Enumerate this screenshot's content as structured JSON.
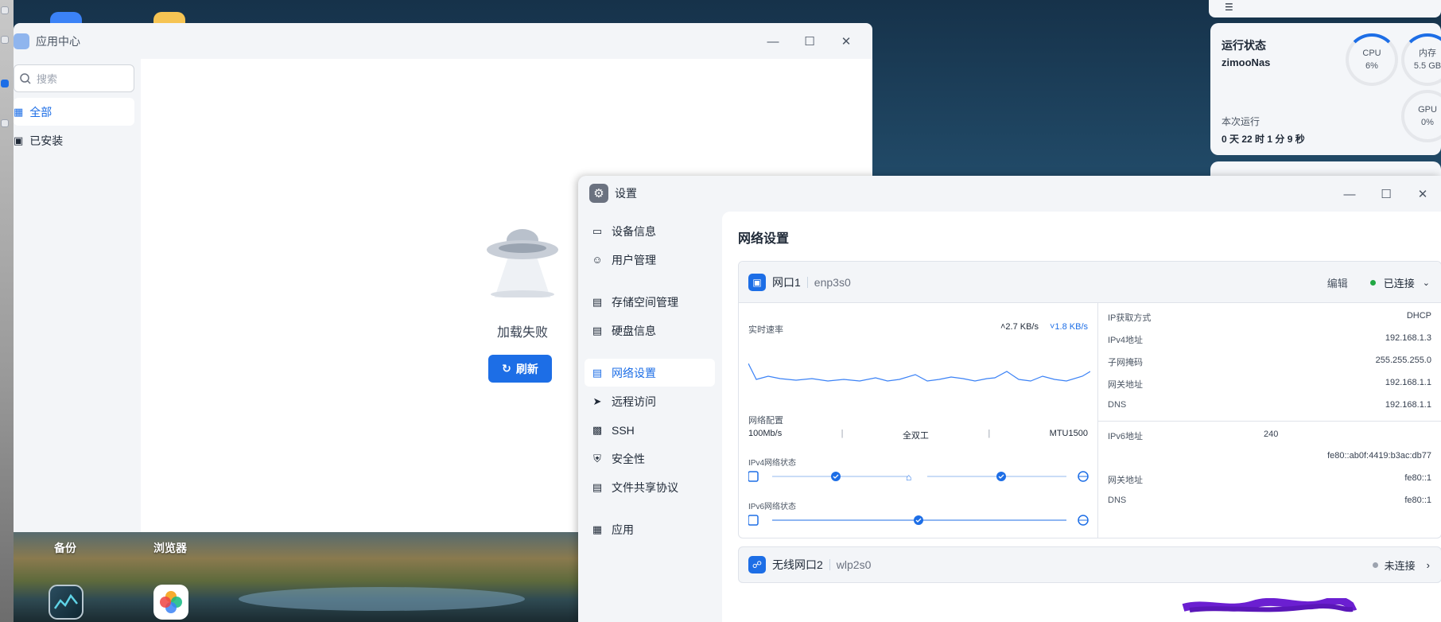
{
  "app_center": {
    "title": "应用中心",
    "search_placeholder": "搜索",
    "nav": [
      {
        "label": "全部"
      },
      {
        "label": "已安装"
      }
    ],
    "empty_state": "加载失败",
    "refresh_label": "刷新"
  },
  "desktop": {
    "labels": [
      "备份",
      "浏览器"
    ]
  },
  "status_widget": {
    "title": "运行状态",
    "host": "zimooNas",
    "uptime_label": "本次运行",
    "uptime_value": "0 天 22 时 1 分 9 秒",
    "gauges": [
      {
        "name": "CPU",
        "value": "6%"
      },
      {
        "name": "内存",
        "value": "5.5 GB"
      },
      {
        "name": "GPU",
        "value": "0%"
      }
    ]
  },
  "settings": {
    "title": "设置",
    "nav": [
      {
        "label": "设备信息",
        "icon": "device-icon"
      },
      {
        "label": "用户管理",
        "icon": "user-icon"
      },
      {
        "label": "存储空间管理",
        "icon": "storage-icon"
      },
      {
        "label": "硬盘信息",
        "icon": "disk-icon"
      },
      {
        "label": "网络设置",
        "icon": "network-icon"
      },
      {
        "label": "远程访问",
        "icon": "remote-icon"
      },
      {
        "label": "SSH",
        "icon": "ssh-icon"
      },
      {
        "label": "安全性",
        "icon": "shield-icon"
      },
      {
        "label": "文件共享协议",
        "icon": "file-share-icon"
      },
      {
        "label": "应用",
        "icon": "apps-icon"
      }
    ],
    "section_title": "网络设置",
    "port1": {
      "name": "网口1",
      "device": "enp3s0",
      "edit_label": "编辑",
      "status": "已连接",
      "speed_label": "实时速率",
      "upload": "2.7 KB/s",
      "download": "1.8 KB/s",
      "config_label": "网络配置",
      "link_speed": "100Mb/s",
      "duplex": "全双工",
      "mtu": "MTU1500",
      "ipv4_state_label": "IPv4网络状态",
      "ipv6_state_label": "IPv6网络状态",
      "ipv4_info": [
        {
          "k": "IP获取方式",
          "v": "DHCP"
        },
        {
          "k": "IPv4地址",
          "v": "192.168.1.3"
        },
        {
          "k": "子网掩码",
          "v": "255.255.255.0"
        },
        {
          "k": "网关地址",
          "v": "192.168.1.1"
        },
        {
          "k": "DNS",
          "v": "192.168.1.1"
        }
      ],
      "ipv6_info": {
        "addr_label": "IPv6地址",
        "addr_visible_prefix": "240",
        "addr_link_local": "fe80::ab0f:4419:b3ac:db77",
        "gateway_label": "网关地址",
        "gateway": "fe80::1",
        "dns_label": "DNS",
        "dns": "fe80::1"
      }
    },
    "port2": {
      "name": "无线网口2",
      "device": "wlp2s0",
      "status": "未连接"
    }
  },
  "colors": {
    "accent": "#1d6ee6",
    "connected": "#22a844",
    "disconnected": "#9ca3af"
  }
}
